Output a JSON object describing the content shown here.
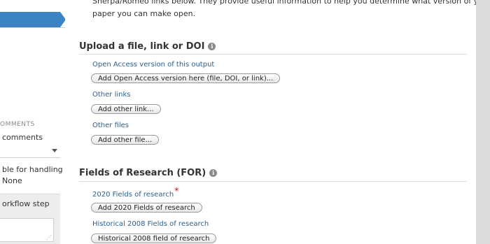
{
  "sidebar": {
    "comments_heading": "OMMENTS",
    "comments_link": "comments",
    "handling_text": "ble for handling",
    "handling_value": "None",
    "workflow_step": "orkflow step",
    "resize_glyph": "⋰"
  },
  "intro": {
    "line1": "Sherpa/Romeo links below. They provide useful information to help you determine what version of your",
    "line2": "paper you can make open."
  },
  "upload": {
    "title": "Upload a file, link or DOI",
    "open_access_label": "Open Access version of this output",
    "open_access_button": "Add Open Access version here (file, DOI, or link)...",
    "other_links_label": "Other links",
    "other_links_button": "Add other link...",
    "other_files_label": "Other files",
    "other_files_button": "Add other file..."
  },
  "for": {
    "title": "Fields of Research (FOR)",
    "fields2020_label": "2020 Fields of research",
    "required_mark": "*",
    "fields2020_button": "Add 2020 Fields of research",
    "fields2008_label": "Historical 2008 Fields of research",
    "fields2008_button": "Historical 2008 field of research"
  },
  "icons": {
    "info": "i"
  }
}
